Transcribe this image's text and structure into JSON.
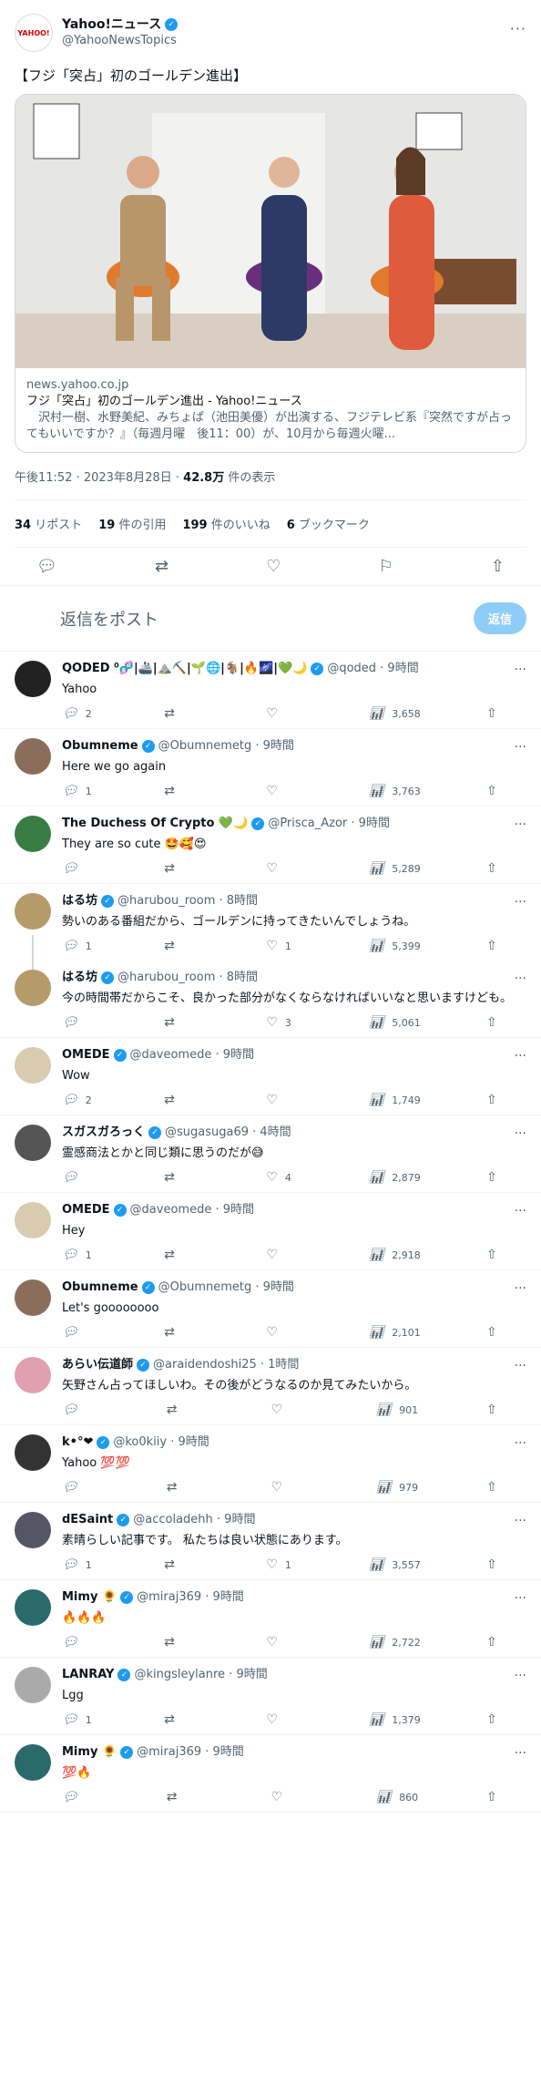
{
  "post": {
    "author": "Yahoo!ニュース",
    "handle": "@YahooNewsTopics",
    "avatar_text": "YAHOO!",
    "text": "【フジ「突占」初のゴールデン進出】",
    "card": {
      "domain": "news.yahoo.co.jp",
      "title": "フジ「突占」初のゴールデン進出 - Yahoo!ニュース",
      "desc": "　沢村一樹、水野美紀、みちょぱ（池田美優）が出演する、フジテレビ系『突然ですが占ってもいいですか？』（毎週月曜　後11：00）が、10月から毎週火曜..."
    },
    "time": "午後11:52 · 2023年8月28日 · ",
    "views": "42.8万",
    "views_label": " 件の表示",
    "stats": [
      {
        "n": "34",
        "l": " リポスト"
      },
      {
        "n": "19",
        "l": " 件の引用"
      },
      {
        "n": "199",
        "l": " 件のいいね"
      },
      {
        "n": "6",
        "l": " ブックマーク"
      }
    ]
  },
  "reply_box": {
    "placeholder": "返信をポスト",
    "button": "返信"
  },
  "replies": [
    {
      "name": "QODED ⁰🧬|🚢|⛰️⛏️|🌱🌐|🐐|🔥🌌|💚🌙",
      "handle": "@qoded · 9時間",
      "text": "Yahoo",
      "r": "2",
      "rt": "",
      "l": "",
      "v": "3,658",
      "color": "#222"
    },
    {
      "name": "Obumneme",
      "handle": "@Obumnemetg · 9時間",
      "text": "Here we go again",
      "r": "1",
      "rt": "",
      "l": "",
      "v": "3,763",
      "color": "#8a6d5a"
    },
    {
      "name": "The Duchess Of Crypto 💚🌙",
      "handle": "@Prisca_Azor · 9時間",
      "text": "They are so cute 🤩🥰😍",
      "r": "",
      "rt": "",
      "l": "",
      "v": "5,289",
      "color": "#3a7d44"
    },
    {
      "name": "はる坊",
      "handle": "@harubou_room · 8時間",
      "text": "勢いのある番組だから、ゴールデンに持ってきたいんでしょうね。",
      "r": "1",
      "rt": "",
      "l": "1",
      "v": "5,399",
      "color": "#b59a6a",
      "thread": true
    },
    {
      "name": "はる坊",
      "handle": "@harubou_room · 8時間",
      "text": "今の時間帯だからこそ、良かった部分がなくならなければいいなと思いますけども。",
      "r": "",
      "rt": "",
      "l": "3",
      "v": "5,061",
      "color": "#b59a6a"
    },
    {
      "name": "OMEDE",
      "handle": "@daveomede · 9時間",
      "text": "Wow",
      "r": "2",
      "rt": "",
      "l": "",
      "v": "1,749",
      "color": "#d9cbb0"
    },
    {
      "name": "スガスガろっく",
      "handle": "@sugasuga69 · 4時間",
      "text": "霊感商法とかと同じ類に思うのだが😅",
      "r": "",
      "rt": "",
      "l": "4",
      "v": "2,879",
      "color": "#555"
    },
    {
      "name": "OMEDE",
      "handle": "@daveomede · 9時間",
      "text": "Hey",
      "r": "1",
      "rt": "",
      "l": "",
      "v": "2,918",
      "color": "#d9cbb0"
    },
    {
      "name": "Obumneme",
      "handle": "@Obumnemetg · 9時間",
      "text": "Let's goooooooo",
      "r": "",
      "rt": "",
      "l": "",
      "v": "2,101",
      "color": "#8a6d5a"
    },
    {
      "name": "あらい伝道師",
      "handle": "@araidendoshi25 · 1時間",
      "text": "矢野さん占ってほしいわ。その後がどうなるのか見てみたいから。",
      "r": "",
      "rt": "",
      "l": "",
      "v": "901",
      "color": "#e0a0b0"
    },
    {
      "name": "k•°❤",
      "handle": "@ko0kiiy · 9時間",
      "text": "Yahoo 💯💯",
      "r": "",
      "rt": "",
      "l": "",
      "v": "979",
      "color": "#333"
    },
    {
      "name": "dESaint",
      "handle": "@accoladehh · 9時間",
      "text": "素晴らしい記事です。 私たちは良い状態にあります。",
      "r": "1",
      "rt": "",
      "l": "1",
      "v": "3,557",
      "color": "#556"
    },
    {
      "name": "Mimy 🌻",
      "handle": "@miraj369 · 9時間",
      "text": "🔥🔥🔥",
      "r": "",
      "rt": "",
      "l": "",
      "v": "2,722",
      "color": "#2a6a6a"
    },
    {
      "name": "LANRAY",
      "handle": "@kingsleylanre · 9時間",
      "text": "Lgg",
      "r": "1",
      "rt": "",
      "l": "",
      "v": "1,379",
      "color": "#aaa"
    },
    {
      "name": "Mimy 🌻",
      "handle": "@miraj369 · 9時間",
      "text": "💯🔥",
      "r": "",
      "rt": "",
      "l": "",
      "v": "860",
      "color": "#2a6a6a"
    }
  ],
  "colors": {
    "accent": "#1d9bf0",
    "muted": "#536471"
  }
}
